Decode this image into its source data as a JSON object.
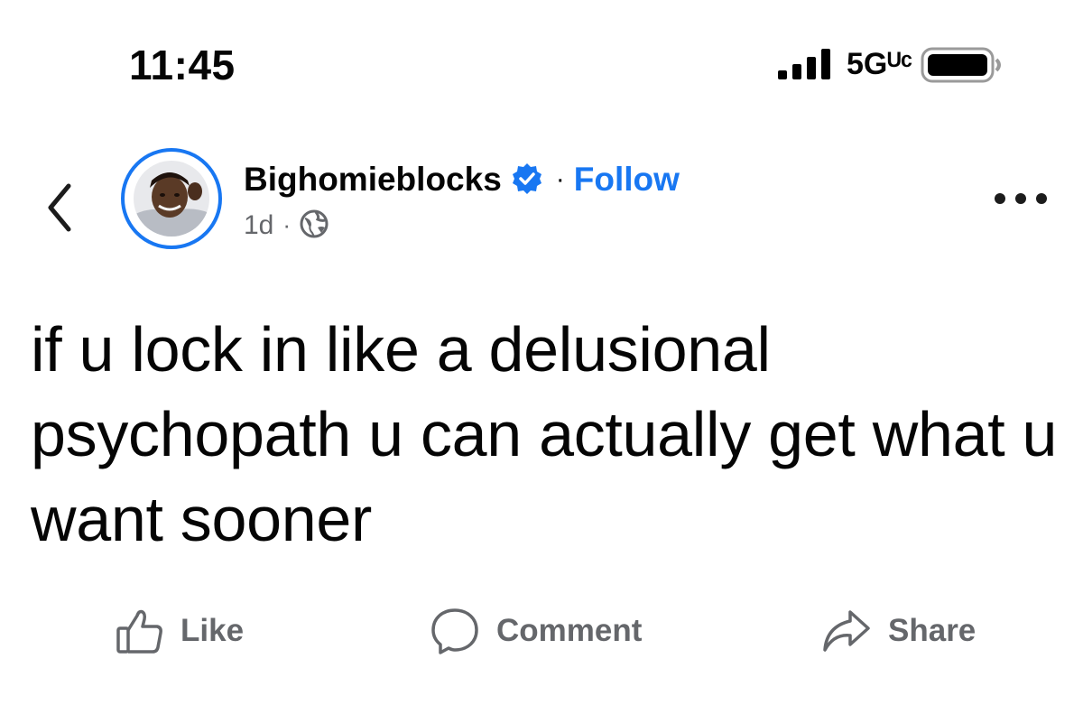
{
  "status_bar": {
    "time": "11:45",
    "network": "5Gᵁᶜ",
    "signal_icon": "signal-bars-icon",
    "battery_icon": "battery-icon"
  },
  "post": {
    "author": "Bighomieblocks",
    "verified_icon": "verified-badge-icon",
    "separator": "·",
    "follow_label": "Follow",
    "age": "1d",
    "meta_separator": "·",
    "audience_icon": "globe-icon",
    "text": "if u lock in like a delusional psychopath u can actually get what u want sooner"
  },
  "actions": {
    "like_label": "Like",
    "comment_label": "Comment",
    "share_label": "Share"
  },
  "colors": {
    "accent": "#1877f2",
    "text": "#050505",
    "secondary": "#65676b"
  }
}
